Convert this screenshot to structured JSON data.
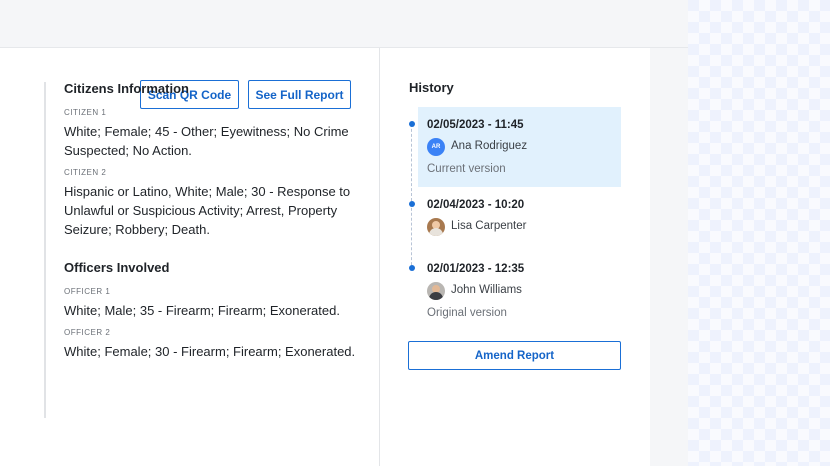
{
  "toolbar": {
    "scan_qr_label": "Scan QR Code",
    "full_report_label": "See Full Report"
  },
  "citizens": {
    "title": "Citizens Information",
    "items": [
      {
        "label": "CITIZEN 1",
        "value": "White; Female; 45 - Other; Eyewitness; No Crime Suspected; No Action."
      },
      {
        "label": "CITIZEN 2",
        "value": "Hispanic or Latino, White; Male; 30 - Response to Unlawful or Suspicious Activity; Arrest, Property Seizure; Robbery; Death."
      }
    ]
  },
  "officers": {
    "title": "Officers Involved",
    "items": [
      {
        "label": "OFFICER 1",
        "value": "White; Male; 35 - Firearm; Firearm; Exonerated."
      },
      {
        "label": "OFFICER 2",
        "value": "White; Female; 30 - Firearm; Firearm; Exonerated."
      }
    ]
  },
  "history": {
    "title": "History",
    "entries": [
      {
        "datetime": "02/05/2023 - 11:45",
        "name": "Ana Rodriguez",
        "initials": "AR",
        "note": "Current version"
      },
      {
        "datetime": "02/04/2023 - 10:20",
        "name": "Lisa Carpenter",
        "initials": "",
        "note": ""
      },
      {
        "datetime": "02/01/2023 - 12:35",
        "name": "John Williams",
        "initials": "",
        "note": "Original version"
      }
    ],
    "amend_label": "Amend Report"
  },
  "colors": {
    "accent": "#1a6fd6",
    "current_highlight": "#e1f1fd"
  }
}
